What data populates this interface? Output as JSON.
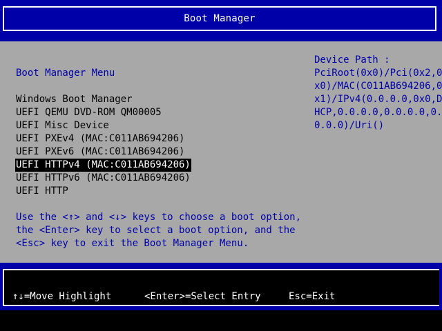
{
  "header": {
    "title": "Boot Manager"
  },
  "menu": {
    "heading": "Boot Manager Menu",
    "items": [
      {
        "label": "Windows Boot Manager"
      },
      {
        "label": "UEFI QEMU DVD-ROM QM00005"
      },
      {
        "label": "UEFI Misc Device"
      },
      {
        "label": "UEFI PXEv4 (MAC:C011AB694206)"
      },
      {
        "label": "UEFI PXEv6 (MAC:C011AB694206)"
      },
      {
        "label": "UEFI HTTPv4 (MAC:C011AB694206)"
      },
      {
        "label": "UEFI HTTPv6 (MAC:C011AB694206)"
      },
      {
        "label": "UEFI HTTP"
      }
    ],
    "selected_label": "UEFI HTTPv4 (MAC:C011AB694206)",
    "instructions": [
      "Use the <↑> and <↓> keys to choose a boot option,",
      "the <Enter> key to select a boot option, and the",
      "<Esc> key to exit the Boot Manager Menu."
    ]
  },
  "device_path": {
    "label": "Device Path :",
    "lines": [
      "PciRoot(0x0)/Pci(0x2,0",
      "x0)/MAC(C011AB694206,0",
      "x1)/IPv4(0.0.0.0,0x0,D",
      "HCP,0.0.0.0,0.0.0.0,0.",
      "0.0.0)/Uri()"
    ]
  },
  "footer": {
    "move_highlight": "↑↓=Move Highlight",
    "select_entry": "<Enter>=Select Entry",
    "exit": "Esc=Exit"
  },
  "colors": {
    "band_blue": "#0000a8",
    "panel_gray": "#a8a8a8",
    "highlight_bg": "#000000",
    "highlight_fg": "#ffffff"
  }
}
